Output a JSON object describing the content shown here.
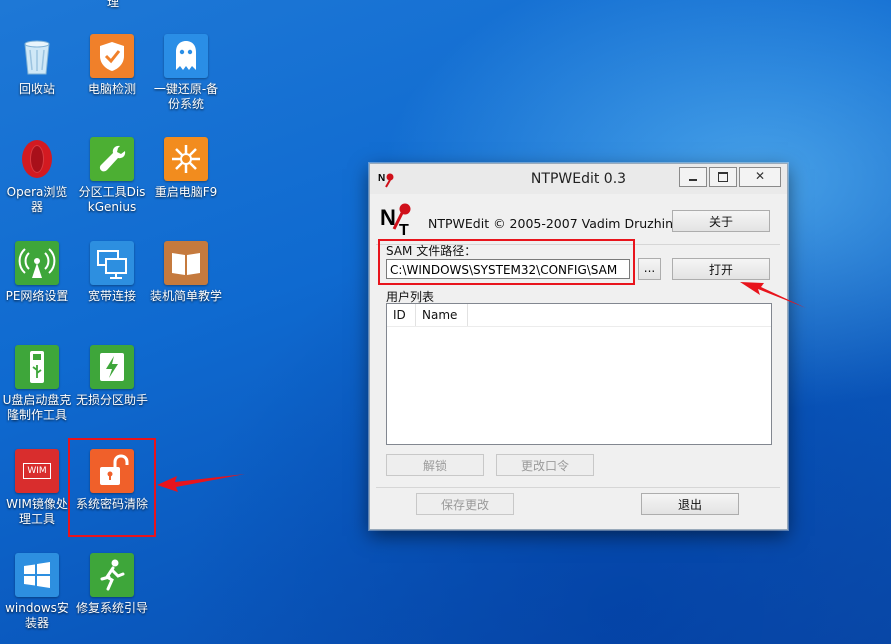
{
  "desktop": {
    "icons": [
      {
        "label": "理"
      },
      {
        "label": "回收站",
        "icon": "recycle-bin-icon"
      },
      {
        "label": "电脑检测",
        "icon": "shield-check-icon",
        "color": "#f0802a"
      },
      {
        "label": "一键还原-备份系统",
        "icon": "ghost-icon",
        "color": "#2a8ee6"
      },
      {
        "label": "Opera浏览器",
        "icon": "opera-icon",
        "color": "#d31a21"
      },
      {
        "label": "分区工具DiskGenius",
        "icon": "wrench-icon",
        "color": "#4caf33"
      },
      {
        "label": "重启电脑F9",
        "icon": "restart-burst-icon",
        "color": "#f28c1e"
      },
      {
        "label": "PE网络设置",
        "icon": "antenna-icon",
        "color": "#3ea63a"
      },
      {
        "label": "宽带连接",
        "icon": "monitors-icon",
        "color": "#2d8fe0"
      },
      {
        "label": "装机简单教学",
        "icon": "book-icon",
        "color": "#c57a3e"
      },
      {
        "label": "U盘启动盘克隆制作工具",
        "icon": "usb-icon",
        "color": "#3ea63a"
      },
      {
        "label": "无损分区助手",
        "icon": "lightning-icon",
        "color": "#3ea63a"
      },
      {
        "label": "WIM镜像处理工具",
        "icon": "wim-icon",
        "color": "#d92d2d",
        "badge": "WIM"
      },
      {
        "label": "系统密码清除",
        "icon": "unlock-icon",
        "color": "#f0602a"
      },
      {
        "label": "windows安装器",
        "icon": "windows-logo-icon",
        "color": "#2d8fe0"
      },
      {
        "label": "修复系统引导",
        "icon": "runner-icon",
        "color": "#3ea63a"
      }
    ]
  },
  "window": {
    "title": "NTPWEdit 0.3",
    "copyright": "NTPWEdit © 2005-2007 Vadim Druzhin",
    "about_label": "关于",
    "sam_label": "SAM 文件路径：",
    "sam_path": "C:\\WINDOWS\\SYSTEM32\\CONFIG\\SAM",
    "browse_label": "...",
    "open_label": "打开",
    "users_label": "用户列表",
    "columns": [
      "ID",
      "Name"
    ],
    "unlock_label": "解锁",
    "change_pw_label": "更改口令",
    "save_label": "保存更改",
    "exit_label": "退出"
  },
  "colors": {
    "highlight": "#e8141c"
  }
}
